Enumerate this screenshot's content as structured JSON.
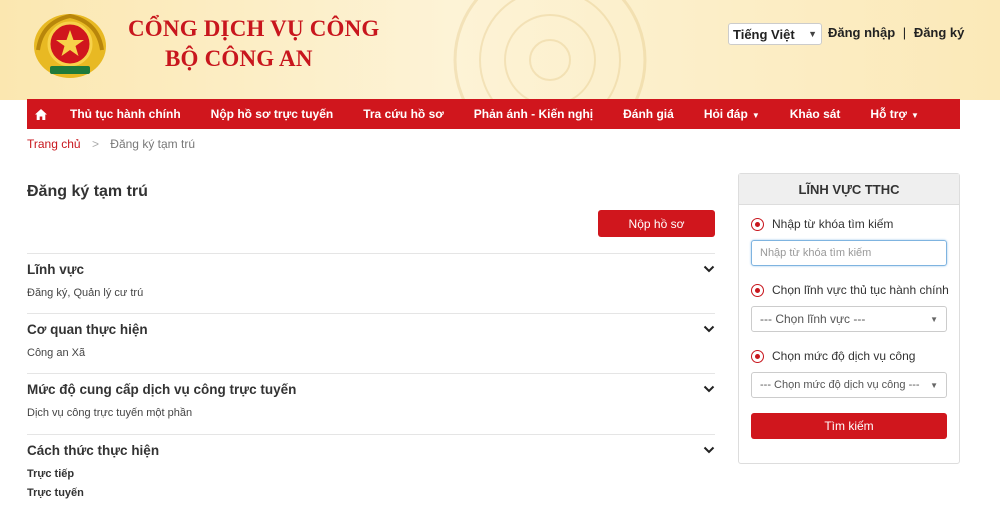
{
  "header": {
    "title_line1": "CỔNG DỊCH VỤ CÔNG",
    "title_line2": "BỘ CÔNG AN",
    "language": "Tiếng Việt",
    "login": "Đăng nhập",
    "separator": "|",
    "register": "Đăng ký"
  },
  "nav": {
    "items": [
      {
        "label": "Thủ tục hành chính"
      },
      {
        "label": "Nộp hồ sơ trực tuyến"
      },
      {
        "label": "Tra cứu hồ sơ"
      },
      {
        "label": "Phản ánh - Kiến nghị"
      },
      {
        "label": "Đánh giá"
      },
      {
        "label": "Hỏi đáp"
      },
      {
        "label": "Khảo sát"
      },
      {
        "label": "Hỗ trợ"
      }
    ]
  },
  "breadcrumb": {
    "home": "Trang chủ",
    "separator": ">",
    "current": "Đăng ký tạm trú"
  },
  "main": {
    "title": "Đăng ký tạm trú",
    "submit_label": "Nộp hồ sơ",
    "sections": [
      {
        "title": "Lĩnh vực",
        "values": [
          "Đăng ký, Quản lý cư trú"
        ]
      },
      {
        "title": "Cơ quan thực hiện",
        "values": [
          "Công an Xã"
        ]
      },
      {
        "title": "Mức độ cung cấp dịch vụ công trực tuyến",
        "values": [
          "Dịch vụ công trực tuyến một phần"
        ]
      },
      {
        "title": "Cách thức thực hiện",
        "values": [
          "Trực tiếp",
          "Trực tuyến"
        ]
      }
    ]
  },
  "sidebar": {
    "heading": "LĨNH VỰC TTHC",
    "keyword_label": "Nhập từ khóa tìm kiếm",
    "keyword_placeholder": "Nhập từ khóa tìm kiếm",
    "field_label": "Chọn lĩnh vực thủ tục hành chính",
    "field_value": "--- Chọn lĩnh vực ---",
    "level_label": "Chọn mức độ dịch vụ công",
    "level_value": "--- Chọn mức độ dịch vụ công ---",
    "search_label": "Tìm kiếm"
  },
  "colors": {
    "brand_red": "#d0161d",
    "header_gold": "#fbe7b0"
  }
}
